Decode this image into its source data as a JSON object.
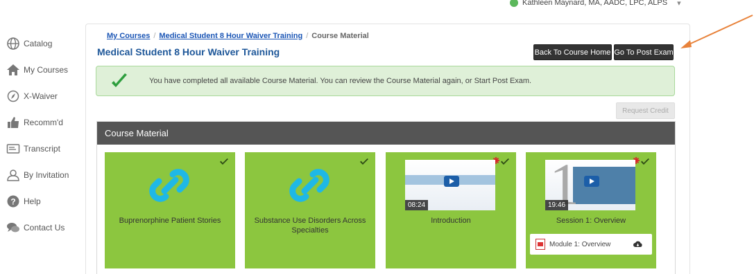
{
  "user": {
    "name": "Kathleen Maynard, MA, AADC, LPC, ALPS"
  },
  "sidebar": {
    "items": [
      {
        "label": "Catalog",
        "icon": "globe-icon"
      },
      {
        "label": "My Courses",
        "icon": "home-icon"
      },
      {
        "label": "X-Waiver",
        "icon": "compass-icon"
      },
      {
        "label": "Recomm'd",
        "icon": "thumbs-up-icon"
      },
      {
        "label": "Transcript",
        "icon": "transcript-icon"
      },
      {
        "label": "By Invitation",
        "icon": "invitation-icon"
      },
      {
        "label": "Help",
        "icon": "help-icon"
      },
      {
        "label": "Contact Us",
        "icon": "chat-icon"
      }
    ]
  },
  "breadcrumb": {
    "my_courses": "My Courses",
    "course": "Medical Student 8 Hour Waiver Training",
    "current": "Course Material",
    "separator": "/"
  },
  "header": {
    "title": "Medical Student 8 Hour Waiver Training",
    "back_label": "Back To Course Home",
    "exam_label": "Go To Post Exam"
  },
  "alert": {
    "message": "You have completed all available Course Material. You can review the Course Material again, or Start Post Exam."
  },
  "request_credit_label": "Request Credit",
  "panel_title": "Course Material",
  "cards": [
    {
      "label": "Buprenorphine Patient Stories",
      "type": "link"
    },
    {
      "label": "Substance Use Disorders Across Specialties",
      "type": "link"
    },
    {
      "label": "Introduction",
      "type": "video",
      "duration": "08:24"
    },
    {
      "label": "Session 1: Overview",
      "type": "video",
      "duration": "19:46",
      "module_label": "Module 1: Overview"
    }
  ],
  "colors": {
    "accent_green": "#8cc63f",
    "title_blue": "#1e5799",
    "link_blue": "#1a55b5"
  }
}
